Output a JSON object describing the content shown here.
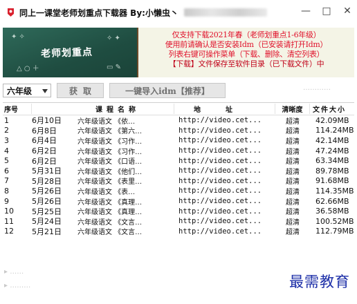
{
  "window": {
    "title": "同上一课堂老师划重点下载器 By:小懒虫丶",
    "minimize_glyph": "—",
    "maximize_glyph": "□",
    "close_glyph": "✕"
  },
  "banner": {
    "chalk_text": "老师划重点",
    "lines": [
      "仅支持下载2021年春（老师划重点1-6年级）",
      "使用前请确认是否安装Idm（已安装请打开Idm）",
      "列表右键可操作菜单（下载、删除、清空列表）",
      "【下载】文件保存至软件目录（已下载文件）中"
    ]
  },
  "toolbar": {
    "grade_value": "六年级",
    "fetch_label": "获取",
    "idm_label": "一键导入idm【推荐】"
  },
  "table": {
    "headers": [
      "序号",
      "课程名称",
      "地址",
      "清晰度",
      "文件大小"
    ],
    "rows": [
      {
        "idx": "1",
        "date": "6月10日",
        "title": "六年级语文 《依…",
        "url": "http://video.cet...",
        "res": "超清",
        "size": "42.09MB"
      },
      {
        "idx": "2",
        "date": "6月8日",
        "title": "六年级语文 《第六…",
        "url": "http://video.cet...",
        "res": "超清",
        "size": "114.24MB"
      },
      {
        "idx": "3",
        "date": "6月4日",
        "title": "六年级语文 《习作…",
        "url": "http://video.cet...",
        "res": "超清",
        "size": "42.14MB"
      },
      {
        "idx": "4",
        "date": "6月2日",
        "title": "六年级语文 《习作…",
        "url": "http://video.cet...",
        "res": "超清",
        "size": "47.24MB"
      },
      {
        "idx": "5",
        "date": "6月2日",
        "title": "六年级语文 《口语…",
        "url": "http://video.cet...",
        "res": "超清",
        "size": "63.34MB"
      },
      {
        "idx": "6",
        "date": "5月31日",
        "title": "六年级语文 《他们…",
        "url": "http://video.cet...",
        "res": "超清",
        "size": "89.78MB"
      },
      {
        "idx": "7",
        "date": "5月28日",
        "title": "六年级语文 《表里…",
        "url": "http://video.cet...",
        "res": "超清",
        "size": "91.68MB"
      },
      {
        "idx": "8",
        "date": "5月26日",
        "title": "六年级语文 《表…",
        "url": "http://video.cet...",
        "res": "超清",
        "size": "114.35MB"
      },
      {
        "idx": "9",
        "date": "5月26日",
        "title": "六年级语文 《真理…",
        "url": "http://video.cet...",
        "res": "超清",
        "size": "62.66MB"
      },
      {
        "idx": "10",
        "date": "5月25日",
        "title": "六年级语文 《真理…",
        "url": "http://video.cet...",
        "res": "超清",
        "size": "36.58MB"
      },
      {
        "idx": "11",
        "date": "5月24日",
        "title": "六年级语文 《文言…",
        "url": "http://video.cet...",
        "res": "超清",
        "size": "100.52MB"
      },
      {
        "idx": "12",
        "date": "5月21日",
        "title": "六年级语文 《文言…",
        "url": "http://video.cet...",
        "res": "超清",
        "size": "112.79MB"
      }
    ]
  },
  "watermark": "最需教育",
  "colors": {
    "banner_text": "#e0102a",
    "chalkboard": "#2f6a5a",
    "watermark": "#1d2fa8"
  }
}
